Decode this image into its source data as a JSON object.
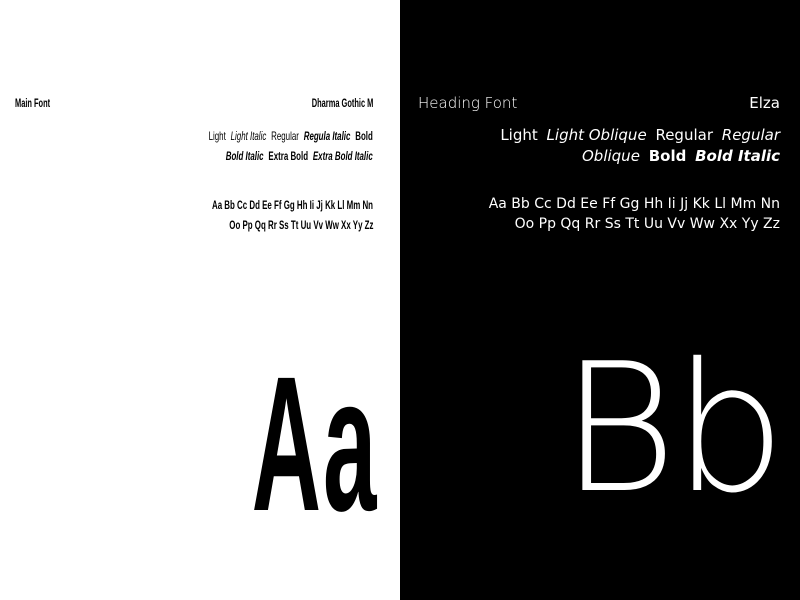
{
  "main_font": {
    "label": "Main Font",
    "name": "Dharma Gothic M",
    "weights_line1": [
      "Light",
      "Light Italic",
      "Regular",
      "Regula Italic",
      "Bold"
    ],
    "weights_line2": [
      "Bold Italic",
      "Extra Bold",
      "Extra Bold Italic"
    ],
    "alphabet_line1": "Aa Bb Cc Dd Ee Ff Gg Hh Ii Jj Kk Ll Mm Nn",
    "alphabet_line2": "Oo Pp Qq Rr Ss Tt  Uu Vv Ww Xx Yy Zz",
    "specimen": "Aa"
  },
  "heading_font": {
    "label": "Heading Font",
    "name": "Elza",
    "weights_line1": [
      "Light",
      "Light Oblique",
      "Regular",
      "Regular"
    ],
    "weights_line2": [
      "Oblique",
      "Bold",
      "Bold Italic"
    ],
    "alphabet_line1": "Aa Bb Cc Dd Ee Ff Gg Hh Ii Jj Kk Ll Mm Nn",
    "alphabet_line2": "Oo Pp Qq Rr Ss Tt  Uu Vv Ww Xx Yy Zz",
    "specimen": "Bb"
  },
  "colors": {
    "left_bg": "#ffffff",
    "left_fg": "#000000",
    "right_bg": "#000000",
    "right_fg": "#ffffff"
  }
}
